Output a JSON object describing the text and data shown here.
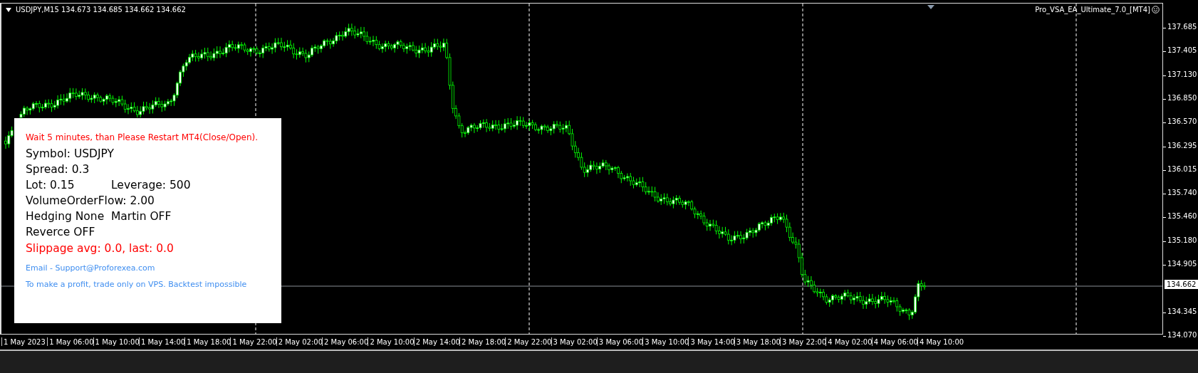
{
  "chart": {
    "symbol_line": "USDJPY,M15  134.673 134.685 134.662 134.662",
    "expert_name": "Pro_VSA_EA_Ultimate_7.0_[MT4]",
    "current_price": "134.662"
  },
  "price_axis": [
    "137.685",
    "137.405",
    "137.130",
    "136.850",
    "136.570",
    "136.295",
    "136.015",
    "135.740",
    "135.460",
    "135.180",
    "134.905",
    "134.345",
    "134.070"
  ],
  "time_axis": [
    "1 May 2023",
    "1 May 06:00",
    "1 May 10:00",
    "1 May 14:00",
    "1 May 18:00",
    "1 May 22:00",
    "2 May 02:00",
    "2 May 06:00",
    "2 May 10:00",
    "2 May 14:00",
    "2 May 18:00",
    "2 May 22:00",
    "3 May 02:00",
    "3 May 06:00",
    "3 May 10:00",
    "3 May 14:00",
    "3 May 18:00",
    "3 May 22:00",
    "4 May 02:00",
    "4 May 06:00",
    "4 May 10:00"
  ],
  "info_panel": [
    {
      "kind": "notice",
      "parts": [
        "Wait 5 minutes, than Please Restart MT4(Close/Open)."
      ]
    },
    {
      "kind": "info",
      "parts": [
        "Symbol: USDJPY"
      ]
    },
    {
      "kind": "info",
      "parts": [
        "Spread: 0.3"
      ]
    },
    {
      "kind": "info",
      "parts": [
        "Lot: 0.15",
        "Leverage: 500"
      ]
    },
    {
      "kind": "info",
      "parts": [
        "VolumeOrderFlow: 2.00"
      ]
    },
    {
      "kind": "info",
      "parts": [
        "Hedging None",
        "Martin OFF"
      ]
    },
    {
      "kind": "info",
      "parts": [
        "Reverce OFF"
      ]
    },
    {
      "kind": "alert",
      "parts": [
        "Slippage avg: 0.0, last: 0.0"
      ]
    },
    {
      "kind": "contact",
      "parts": [
        "Email - Support@Proforexea.com"
      ]
    },
    {
      "kind": "contact",
      "parts": [
        "To make a profit, trade only on VPS. Backtest impossible"
      ]
    }
  ]
}
